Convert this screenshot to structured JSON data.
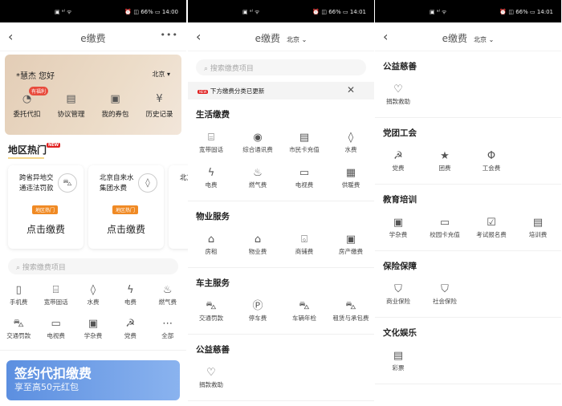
{
  "status": {
    "signal": "▣ ᵃˡ ᯤ",
    "p1_right": "⏰ ◫ 66% ▭ 14:00",
    "p2_right": "⏰ ◫ 66% ▭ 14:01",
    "p3_right": "⏰ ◫ 66% ▭ 14:01"
  },
  "header": {
    "title": "e缴费",
    "city": "北京 ⌄",
    "back": "‹",
    "more": "•••"
  },
  "home": {
    "greeting": "*慧杰 您好",
    "city": "北京 ▾",
    "quick": [
      {
        "label": "委托代扣",
        "icon": "auto-pay-icon",
        "glyph": "◔",
        "badge": "有福利"
      },
      {
        "label": "协议管理",
        "icon": "agreement-icon",
        "glyph": "▤"
      },
      {
        "label": "我的券包",
        "icon": "wallet-icon",
        "glyph": "▣"
      },
      {
        "label": "历史记录",
        "icon": "history-icon",
        "glyph": "¥"
      }
    ],
    "hot_title": "地区热门",
    "hot_new": "NEW",
    "hot_cards": [
      {
        "title": "跨省异地交通违法罚款",
        "icon": "car-icon",
        "glyph": "⛍",
        "tag": "地区热门",
        "action": "点击缴费"
      },
      {
        "title": "北京自来水集团水费",
        "icon": "water-drop-icon",
        "glyph": "◊",
        "tag": "地区热门",
        "action": "点击缴费"
      },
      {
        "title": "北京",
        "icon": "",
        "glyph": "",
        "tag": "",
        "action": ""
      }
    ],
    "search_placeholder": "搜索缴费项目",
    "grid": [
      {
        "label": "手机费",
        "icon": "phone-icon",
        "glyph": "▯"
      },
      {
        "label": "宽带固话",
        "icon": "router-icon",
        "glyph": "⌸"
      },
      {
        "label": "水费",
        "icon": "water-drop-icon",
        "glyph": "◊"
      },
      {
        "label": "电费",
        "icon": "lightning-icon",
        "glyph": "ϟ"
      },
      {
        "label": "燃气费",
        "icon": "flame-icon",
        "glyph": "♨"
      },
      {
        "label": "交通罚款",
        "icon": "car-icon",
        "glyph": "⛍"
      },
      {
        "label": "电视费",
        "icon": "tv-icon",
        "glyph": "▭"
      },
      {
        "label": "学杂费",
        "icon": "tuition-icon",
        "glyph": "▣"
      },
      {
        "label": "党费",
        "icon": "party-icon",
        "glyph": "☭"
      },
      {
        "label": "全部",
        "icon": "more-icon",
        "glyph": "⋯"
      }
    ],
    "banner_title": "签约代扣缴费",
    "banner_sub": "享至高50元红包"
  },
  "catalog": {
    "search_placeholder": "搜索缴费项目",
    "notice": "下方缴费分类已更新",
    "notice_badge": "NEW",
    "close": "✕",
    "p2_sections": [
      {
        "title": "生活缴费",
        "items": [
          {
            "label": "宽带固话",
            "icon": "router-icon",
            "glyph": "⌸"
          },
          {
            "label": "综合通讯费",
            "icon": "antenna-icon",
            "glyph": "◉"
          },
          {
            "label": "市民卡充值",
            "icon": "id-card-icon",
            "glyph": "▤"
          },
          {
            "label": "水费",
            "icon": "water-drop-icon",
            "glyph": "◊"
          },
          {
            "label": "电费",
            "icon": "lightning-icon",
            "glyph": "ϟ"
          },
          {
            "label": "燃气费",
            "icon": "flame-icon",
            "glyph": "♨"
          },
          {
            "label": "电视费",
            "icon": "tv-icon",
            "glyph": "▭"
          },
          {
            "label": "供暖费",
            "icon": "heater-icon",
            "glyph": "▦"
          }
        ]
      },
      {
        "title": "物业服务",
        "items": [
          {
            "label": "房租",
            "icon": "house-icon",
            "glyph": "⌂"
          },
          {
            "label": "物业费",
            "icon": "house-icon",
            "glyph": "⌂"
          },
          {
            "label": "商铺费",
            "icon": "shop-icon",
            "glyph": "⌺"
          },
          {
            "label": "房产缴费",
            "icon": "property-icon",
            "glyph": "▣"
          }
        ]
      },
      {
        "title": "车主服务",
        "items": [
          {
            "label": "交通罚款",
            "icon": "car-icon",
            "glyph": "⛍"
          },
          {
            "label": "停车费",
            "icon": "parking-icon",
            "glyph": "Ⓟ"
          },
          {
            "label": "车辆年检",
            "icon": "car-icon",
            "glyph": "⛍"
          },
          {
            "label": "租赁与承包费",
            "icon": "car-icon",
            "glyph": "⛍"
          }
        ]
      },
      {
        "title": "公益慈善",
        "items": [
          {
            "label": "捐款救助",
            "icon": "heart-icon",
            "glyph": "♡"
          }
        ]
      }
    ],
    "p3_sections": [
      {
        "title": "公益慈善",
        "items": [
          {
            "label": "捐款救助",
            "icon": "heart-icon",
            "glyph": "♡"
          }
        ]
      },
      {
        "title": "党团工会",
        "items": [
          {
            "label": "党费",
            "icon": "party-icon",
            "glyph": "☭"
          },
          {
            "label": "团费",
            "icon": "star-icon",
            "glyph": "★"
          },
          {
            "label": "工会费",
            "icon": "union-icon",
            "glyph": "Φ"
          }
        ]
      },
      {
        "title": "教育培训",
        "items": [
          {
            "label": "学杂费",
            "icon": "tuition-icon",
            "glyph": "▣"
          },
          {
            "label": "校园卡充值",
            "icon": "card-icon",
            "glyph": "▭"
          },
          {
            "label": "考试报名费",
            "icon": "exam-icon",
            "glyph": "☑"
          },
          {
            "label": "培训费",
            "icon": "training-icon",
            "glyph": "▤"
          }
        ]
      },
      {
        "title": "保险保障",
        "items": [
          {
            "label": "商业保险",
            "icon": "shield-icon",
            "glyph": "⛉"
          },
          {
            "label": "社会保险",
            "icon": "shield-person-icon",
            "glyph": "⛉"
          }
        ]
      },
      {
        "title": "文化娱乐",
        "items": [
          {
            "label": "彩票",
            "icon": "lottery-icon",
            "glyph": "▤"
          }
        ]
      }
    ]
  }
}
